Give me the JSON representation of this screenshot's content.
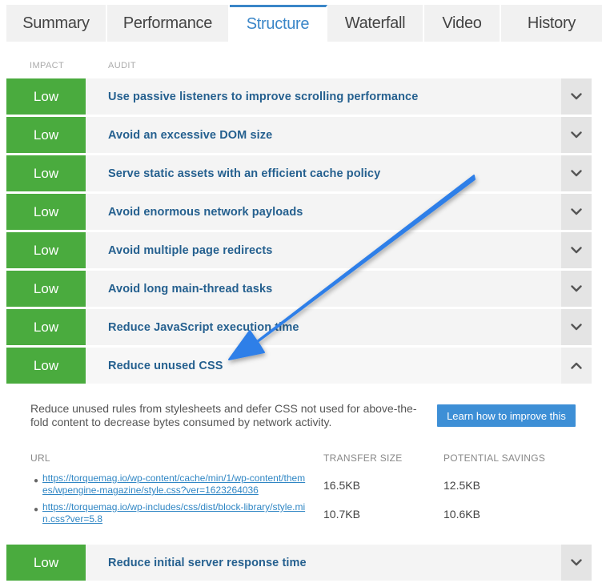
{
  "tabs": [
    {
      "label": "Summary",
      "active": false
    },
    {
      "label": "Performance",
      "active": false
    },
    {
      "label": "Structure",
      "active": true
    },
    {
      "label": "Waterfall",
      "active": false
    },
    {
      "label": "Video",
      "active": false
    },
    {
      "label": "History",
      "active": false
    }
  ],
  "columns": {
    "impact": "IMPACT",
    "audit": "AUDIT"
  },
  "audits": [
    {
      "impact": "Low",
      "title": "Use passive listeners to improve scrolling performance",
      "toggle_icon": "chevron-down-icon"
    },
    {
      "impact": "Low",
      "title": "Avoid an excessive DOM size",
      "toggle_icon": "chevron-down-icon"
    },
    {
      "impact": "Low",
      "title": "Serve static assets with an efficient cache policy",
      "toggle_icon": "chevron-down-icon"
    },
    {
      "impact": "Low",
      "title": "Avoid enormous network payloads",
      "toggle_icon": "chevron-down-icon"
    },
    {
      "impact": "Low",
      "title": "Avoid multiple page redirects",
      "toggle_icon": "chevron-down-icon"
    },
    {
      "impact": "Low",
      "title": "Avoid long main-thread tasks",
      "toggle_icon": "chevron-down-icon"
    },
    {
      "impact": "Low",
      "title": "Reduce JavaScript execution time",
      "toggle_icon": "chevron-down-icon"
    },
    {
      "impact": "Low",
      "title": "Reduce unused CSS",
      "toggle_icon": "chevron-up-icon"
    },
    {
      "impact": "Low",
      "title": "Reduce initial server response time",
      "toggle_icon": "chevron-down-icon"
    }
  ],
  "expanded": {
    "description": "Reduce unused rules from stylesheets and defer CSS not used for above-the-fold content to decrease bytes consumed by network activity.",
    "button_label": "Learn how to improve this",
    "headers": {
      "url": "URL",
      "transfer_size": "TRANSFER SIZE",
      "savings": "POTENTIAL SAVINGS"
    },
    "resources": [
      {
        "url": "https://torquemag.io/wp-content/cache/min/1/wp-content/themes/wpengine-magazine/style.css?ver=1623264036",
        "transfer_size": "16.5KB",
        "savings": "12.5KB"
      },
      {
        "url": "https://torquemag.io/wp-includes/css/dist/block-library/style.min.css?ver=5.8",
        "transfer_size": "10.7KB",
        "savings": "10.6KB"
      }
    ]
  },
  "colors": {
    "accent": "#3a86c8",
    "impact_low": "#4aab3e",
    "audit_title": "#25608f",
    "button": "#3d8fd6",
    "annotation_arrow": "#2f7fe8"
  }
}
